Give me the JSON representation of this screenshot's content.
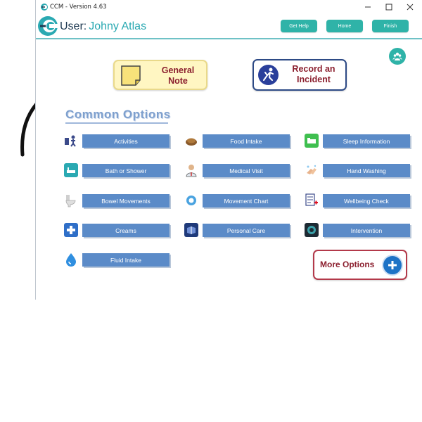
{
  "window": {
    "title": "CCM - Version 4.63",
    "controls": {
      "minimize_icon": "minimize-icon",
      "maximize_icon": "maximize-icon",
      "close_icon": "close-icon"
    }
  },
  "header": {
    "user_prefix": "User:",
    "user_name": "Johny Atlas",
    "buttons": [
      "Get Help",
      "Home",
      "Finish"
    ]
  },
  "quick_actions": {
    "general_note": "General Note",
    "record_incident": "Record an Incident"
  },
  "section_title": "Common Options",
  "options": [
    {
      "label": "Activities",
      "icon": "activities-icon"
    },
    {
      "label": "Food Intake",
      "icon": "food-icon"
    },
    {
      "label": "Sleep Information",
      "icon": "sleep-icon"
    },
    {
      "label": "Bath or Shower",
      "icon": "bath-icon"
    },
    {
      "label": "Medical Visit",
      "icon": "doctor-icon"
    },
    {
      "label": "Hand Washing",
      "icon": "hand-washing-icon"
    },
    {
      "label": "Bowel Movements",
      "icon": "toilet-icon"
    },
    {
      "label": "Movement Chart",
      "icon": "movement-icon"
    },
    {
      "label": "Wellbeing Check",
      "icon": "checklist-icon"
    },
    {
      "label": "Creams",
      "icon": "creams-icon"
    },
    {
      "label": "Personal Care",
      "icon": "personal-care-icon"
    },
    {
      "label": "Intervention",
      "icon": "intervention-icon"
    },
    {
      "label": "Fluid Intake",
      "icon": "water-drop-icon"
    }
  ],
  "more_options": "More Options",
  "colors": {
    "teal": "#2fb3a8",
    "option_blue": "#5b8bc8",
    "accent_red": "#8b1f2e"
  }
}
